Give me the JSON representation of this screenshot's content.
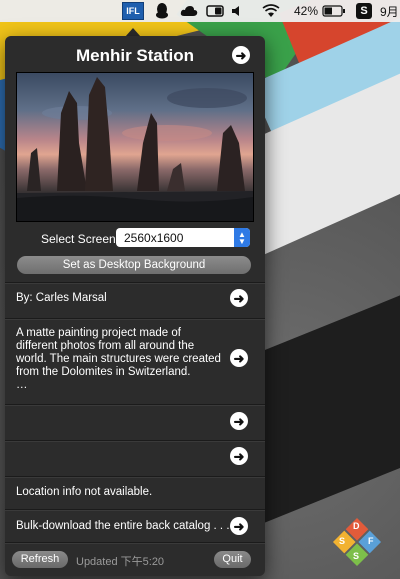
{
  "menubar": {
    "ifl_label": "IFL",
    "battery_text": "42%",
    "s_label": "S",
    "date_text": "9月"
  },
  "popover": {
    "title": "Menhir Station",
    "select_screen_label": "Select Screen",
    "screen_value": "2560x1600",
    "set_desktop_label": "Set as Desktop Background",
    "author": "By: Carles Marsal",
    "description_line1": "A matte painting project made of",
    "description_line2": "different photos from all around the",
    "description_line3": "world. The main structures were created",
    "description_line4": "from the Dolomites in Switzerland.",
    "description_line5": "…",
    "location": "Location info not available.",
    "bulk": "Bulk-download the entire back catalog . . .",
    "refresh_label": "Refresh",
    "updated_text": "Updated 下午5:20",
    "quit_label": "Quit"
  },
  "logo": {
    "letters": [
      "D",
      "S",
      "F",
      "S"
    ]
  },
  "colors": {
    "accent_blue": "#2f7ae5",
    "popover_bg": "#2c2c2c",
    "ifl_blue": "#1f5fae"
  }
}
